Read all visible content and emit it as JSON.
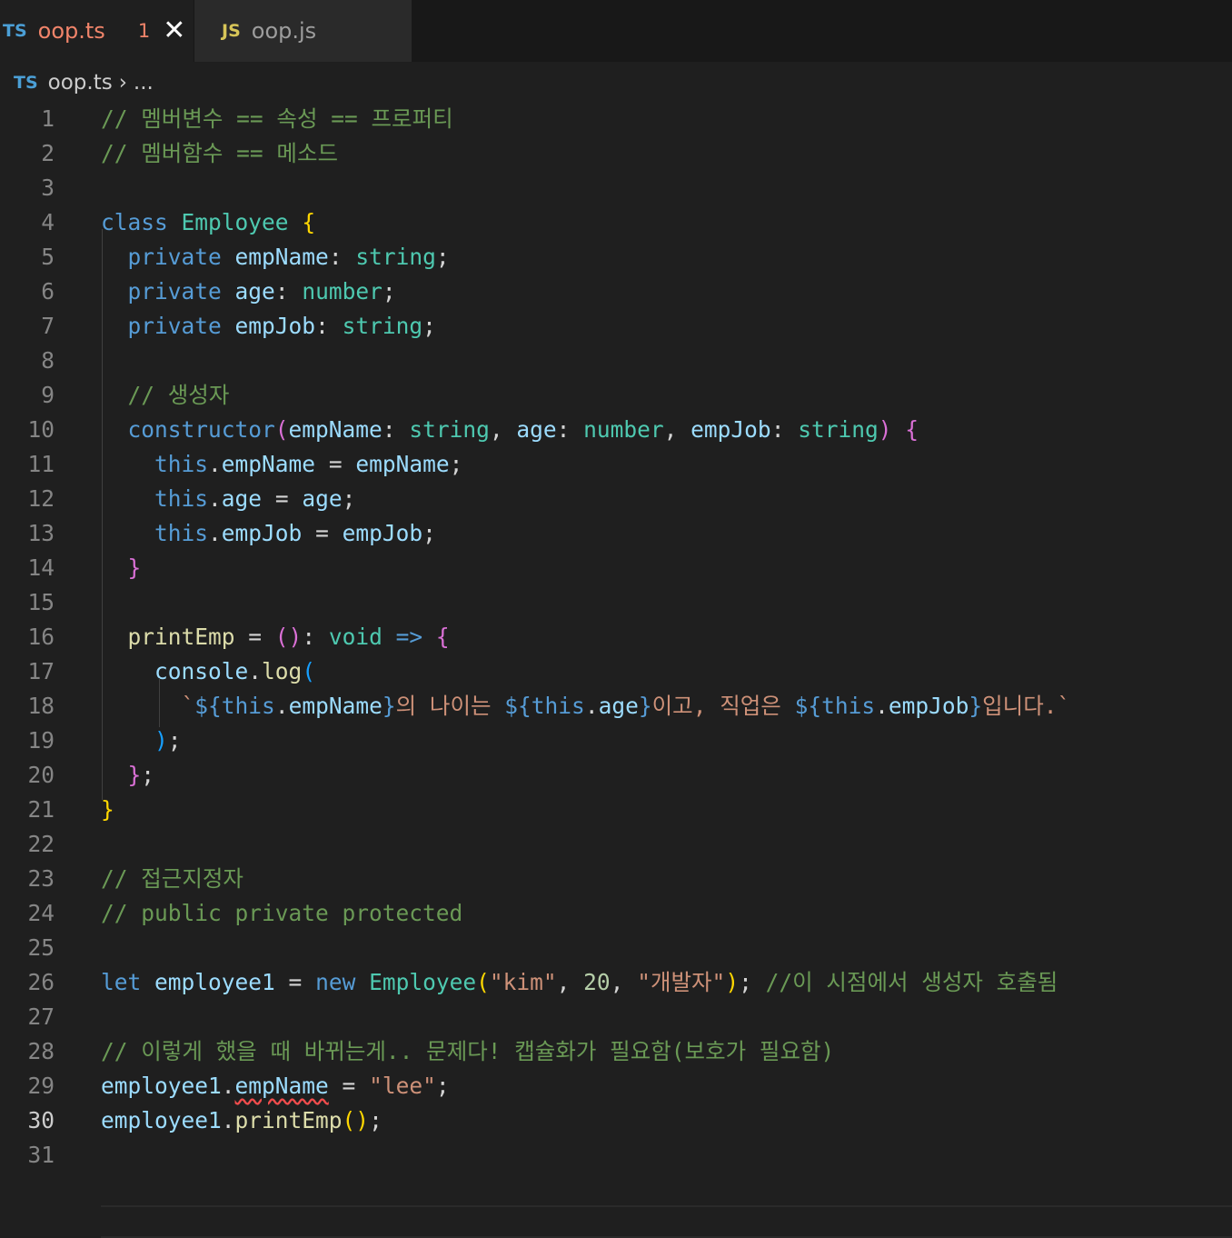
{
  "tabs": [
    {
      "lang": "TS",
      "name": "oop.ts",
      "problems": "1",
      "close": "✕"
    },
    {
      "lang": "JS",
      "name": "oop.js"
    }
  ],
  "breadcrumb": {
    "lang": "TS",
    "file": "oop.ts",
    "sep": "›",
    "more": "..."
  },
  "current_line": "30",
  "lines": [
    [
      {
        "t": "// 멤버변수 == 속성 == 프로퍼티",
        "c": "cm"
      }
    ],
    [
      {
        "t": "// 멤버함수 == 메소드",
        "c": "cm"
      }
    ],
    [],
    [
      {
        "t": "class",
        "c": "kw"
      },
      {
        "t": " "
      },
      {
        "t": "Employee",
        "c": "cls"
      },
      {
        "t": " "
      },
      {
        "t": "{",
        "c": "p1"
      }
    ],
    [
      {
        "t": "  "
      },
      {
        "t": "private",
        "c": "kw"
      },
      {
        "t": " "
      },
      {
        "t": "empName",
        "c": "prop"
      },
      {
        "t": ": "
      },
      {
        "t": "string",
        "c": "cls"
      },
      {
        "t": ";"
      }
    ],
    [
      {
        "t": "  "
      },
      {
        "t": "private",
        "c": "kw"
      },
      {
        "t": " "
      },
      {
        "t": "age",
        "c": "prop"
      },
      {
        "t": ": "
      },
      {
        "t": "number",
        "c": "cls"
      },
      {
        "t": ";"
      }
    ],
    [
      {
        "t": "  "
      },
      {
        "t": "private",
        "c": "kw"
      },
      {
        "t": " "
      },
      {
        "t": "empJob",
        "c": "prop"
      },
      {
        "t": ": "
      },
      {
        "t": "string",
        "c": "cls"
      },
      {
        "t": ";"
      }
    ],
    [],
    [
      {
        "t": "  "
      },
      {
        "t": "// 생성자",
        "c": "cm"
      }
    ],
    [
      {
        "t": "  "
      },
      {
        "t": "constructor",
        "c": "kw"
      },
      {
        "t": "(",
        "c": "p2"
      },
      {
        "t": "empName",
        "c": "prop"
      },
      {
        "t": ": "
      },
      {
        "t": "string",
        "c": "cls"
      },
      {
        "t": ", "
      },
      {
        "t": "age",
        "c": "prop"
      },
      {
        "t": ": "
      },
      {
        "t": "number",
        "c": "cls"
      },
      {
        "t": ", "
      },
      {
        "t": "empJob",
        "c": "prop"
      },
      {
        "t": ": "
      },
      {
        "t": "string",
        "c": "cls"
      },
      {
        "t": ")",
        "c": "p2"
      },
      {
        "t": " "
      },
      {
        "t": "{",
        "c": "p2"
      }
    ],
    [
      {
        "t": "    "
      },
      {
        "t": "this",
        "c": "kw"
      },
      {
        "t": "."
      },
      {
        "t": "empName",
        "c": "prop"
      },
      {
        "t": " = "
      },
      {
        "t": "empName",
        "c": "prop"
      },
      {
        "t": ";"
      }
    ],
    [
      {
        "t": "    "
      },
      {
        "t": "this",
        "c": "kw"
      },
      {
        "t": "."
      },
      {
        "t": "age",
        "c": "prop"
      },
      {
        "t": " = "
      },
      {
        "t": "age",
        "c": "prop"
      },
      {
        "t": ";"
      }
    ],
    [
      {
        "t": "    "
      },
      {
        "t": "this",
        "c": "kw"
      },
      {
        "t": "."
      },
      {
        "t": "empJob",
        "c": "prop"
      },
      {
        "t": " = "
      },
      {
        "t": "empJob",
        "c": "prop"
      },
      {
        "t": ";"
      }
    ],
    [
      {
        "t": "  "
      },
      {
        "t": "}",
        "c": "p2"
      }
    ],
    [],
    [
      {
        "t": "  "
      },
      {
        "t": "printEmp",
        "c": "fn"
      },
      {
        "t": " = "
      },
      {
        "t": "()",
        "c": "p2"
      },
      {
        "t": ": "
      },
      {
        "t": "void",
        "c": "cls"
      },
      {
        "t": " "
      },
      {
        "t": "=>",
        "c": "kw"
      },
      {
        "t": " "
      },
      {
        "t": "{",
        "c": "p2"
      }
    ],
    [
      {
        "t": "    "
      },
      {
        "t": "console",
        "c": "prop"
      },
      {
        "t": "."
      },
      {
        "t": "log",
        "c": "fn"
      },
      {
        "t": "(",
        "c": "p3"
      }
    ],
    [
      {
        "t": "      "
      },
      {
        "t": "`",
        "c": "str"
      },
      {
        "t": "${",
        "c": "kw"
      },
      {
        "t": "this",
        "c": "kw"
      },
      {
        "t": "."
      },
      {
        "t": "empName",
        "c": "prop"
      },
      {
        "t": "}",
        "c": "kw"
      },
      {
        "t": "의 나이는 ",
        "c": "str"
      },
      {
        "t": "${",
        "c": "kw"
      },
      {
        "t": "this",
        "c": "kw"
      },
      {
        "t": "."
      },
      {
        "t": "age",
        "c": "prop"
      },
      {
        "t": "}",
        "c": "kw"
      },
      {
        "t": "이고, 직업은 ",
        "c": "str"
      },
      {
        "t": "${",
        "c": "kw"
      },
      {
        "t": "this",
        "c": "kw"
      },
      {
        "t": "."
      },
      {
        "t": "empJob",
        "c": "prop"
      },
      {
        "t": "}",
        "c": "kw"
      },
      {
        "t": "입니다.`",
        "c": "str"
      }
    ],
    [
      {
        "t": "    "
      },
      {
        "t": ")",
        "c": "p3"
      },
      {
        "t": ";"
      }
    ],
    [
      {
        "t": "  "
      },
      {
        "t": "}",
        "c": "p2"
      },
      {
        "t": ";"
      }
    ],
    [
      {
        "t": "}",
        "c": "p1"
      }
    ],
    [],
    [
      {
        "t": "// 접근지정자",
        "c": "cm"
      }
    ],
    [
      {
        "t": "// public private protected",
        "c": "cm"
      }
    ],
    [],
    [
      {
        "t": "let",
        "c": "kw"
      },
      {
        "t": " "
      },
      {
        "t": "employee1",
        "c": "prop"
      },
      {
        "t": " = "
      },
      {
        "t": "new",
        "c": "kw"
      },
      {
        "t": " "
      },
      {
        "t": "Employee",
        "c": "cls"
      },
      {
        "t": "(",
        "c": "p1"
      },
      {
        "t": "\"kim\"",
        "c": "str"
      },
      {
        "t": ", "
      },
      {
        "t": "20",
        "c": "num"
      },
      {
        "t": ", "
      },
      {
        "t": "\"개발자\"",
        "c": "str"
      },
      {
        "t": ")",
        "c": "p1"
      },
      {
        "t": "; "
      },
      {
        "t": "//이 시점에서 생성자 호출됨",
        "c": "cm"
      }
    ],
    [],
    [
      {
        "t": "// 이렇게 했을 때 바뀌는게.. 문제다! 캡슐화가 필요함(보호가 필요함)",
        "c": "cm"
      }
    ],
    [
      {
        "t": "employee1",
        "c": "prop"
      },
      {
        "t": "."
      },
      {
        "t": "empName",
        "c": "prop err"
      },
      {
        "t": " = "
      },
      {
        "t": "\"lee\"",
        "c": "str"
      },
      {
        "t": ";"
      }
    ],
    [
      {
        "t": "employee1",
        "c": "prop"
      },
      {
        "t": "."
      },
      {
        "t": "printEmp",
        "c": "fn"
      },
      {
        "t": "()",
        "c": "p1"
      },
      {
        "t": ";"
      }
    ],
    []
  ]
}
